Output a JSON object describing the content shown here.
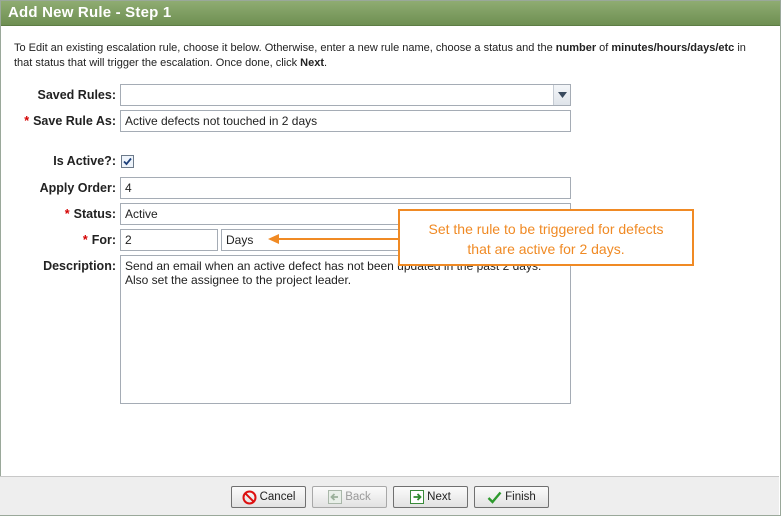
{
  "window": {
    "title": "Add New Rule - Step 1"
  },
  "intro": {
    "part1": "To Edit an existing escalation rule, choose it below. Otherwise, enter a new rule name, choose a status and the ",
    "bold1": "number",
    "part2": " of ",
    "bold2": "minutes/hours/days/etc",
    "part3": " in that status that will trigger the escalation. Once done, click ",
    "bold3": "Next",
    "part4": "."
  },
  "form": {
    "saved_rules": {
      "label": "Saved Rules:",
      "value": ""
    },
    "save_rule_as": {
      "label": "Save Rule As:",
      "value": "Active defects not touched in 2 days",
      "required": "*"
    },
    "is_active": {
      "label": "Is Active?:",
      "checked": true
    },
    "apply_order": {
      "label": "Apply Order:",
      "value": "4"
    },
    "status": {
      "label": "Status:",
      "value": "Active",
      "required": "*"
    },
    "for": {
      "label": "For:",
      "number": "2",
      "unit": "Days",
      "required": "*"
    },
    "description": {
      "label": "Description:",
      "value": "Send an email when an active defect has not been updated in the past 2 days.\nAlso set the assignee to the project leader."
    }
  },
  "callout": {
    "line1": "Set the rule to be triggered for defects",
    "line2": "that are active for 2 days."
  },
  "buttons": {
    "cancel": "Cancel",
    "back": "Back",
    "next": "Next",
    "finish": "Finish"
  },
  "colors": {
    "titlebar": "#7a9a5e",
    "callout": "#f08a24",
    "required": "#d40000"
  }
}
